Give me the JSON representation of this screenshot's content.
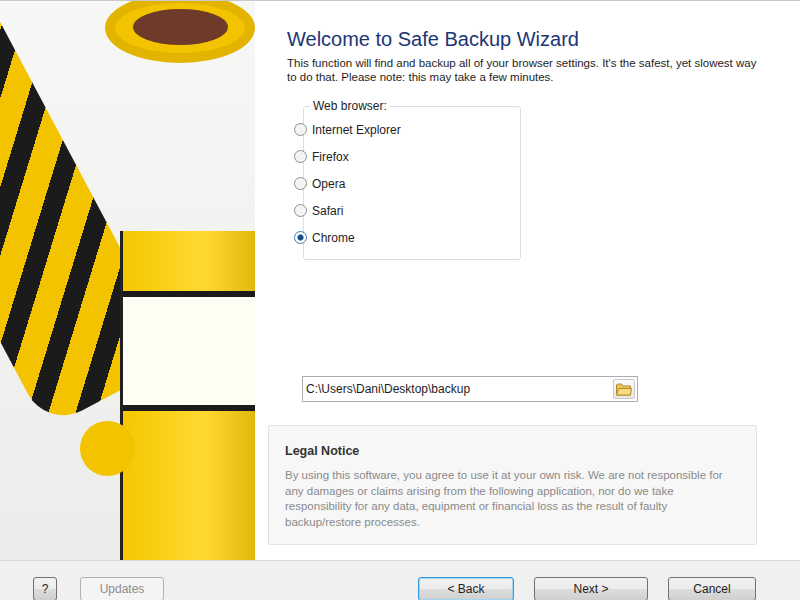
{
  "header": {
    "title": "Welcome to Safe Backup Wizard",
    "description": "This function will find and backup all of your browser settings. It's the safest, yet slowest way to do that. Please note: this may take a few minutes."
  },
  "browser_group": {
    "label": "Web browser:",
    "options": [
      {
        "label": "Internet Explorer",
        "selected": false
      },
      {
        "label": "Firefox",
        "selected": false
      },
      {
        "label": "Opera",
        "selected": false
      },
      {
        "label": "Safari",
        "selected": false
      },
      {
        "label": "Chrome",
        "selected": true
      }
    ]
  },
  "path_field": {
    "value": "C:\\Users\\Dani\\Desktop\\backup"
  },
  "legal_notice": {
    "title": "Legal Notice",
    "text": "By using this software, you agree to use it at your own risk. We are not responsible for any damages or claims arising from the following application, nor do we take responsibility for any data, equipment or financial loss as the result of faulty backup/restore processes."
  },
  "footer": {
    "left_buttons": [
      {
        "label": "?",
        "disabled": false,
        "focused": false
      },
      {
        "label": "Updates",
        "disabled": true,
        "focused": false
      }
    ],
    "right_buttons": [
      {
        "label": "< Back",
        "disabled": false,
        "focused": true
      },
      {
        "label": "Next >",
        "disabled": false,
        "focused": false
      },
      {
        "label": "Cancel",
        "disabled": false,
        "focused": false
      }
    ]
  }
}
